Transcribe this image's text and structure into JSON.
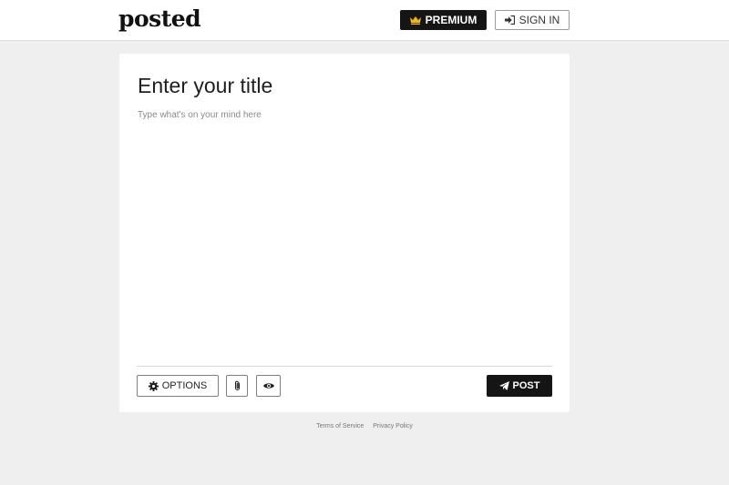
{
  "header": {
    "logo": "posted",
    "premium_label": "PREMIUM",
    "signin_label": "SIGN IN"
  },
  "editor": {
    "title_placeholder": "Enter your title",
    "body_placeholder": "Type what's on your mind here"
  },
  "toolbar": {
    "options_label": "OPTIONS",
    "post_label": "POST"
  },
  "icons": {
    "premium": "crown-icon",
    "signin": "sign-in-icon",
    "options": "gear-icon",
    "attach": "paperclip-icon",
    "preview": "eye-icon",
    "post": "paper-plane-icon"
  },
  "footer": {
    "terms": "Terms of Service",
    "privacy": "Privacy Policy"
  },
  "colors": {
    "page_bg": "#efefef",
    "dark_button": "#151515",
    "crown_gold": "#f0b323"
  }
}
